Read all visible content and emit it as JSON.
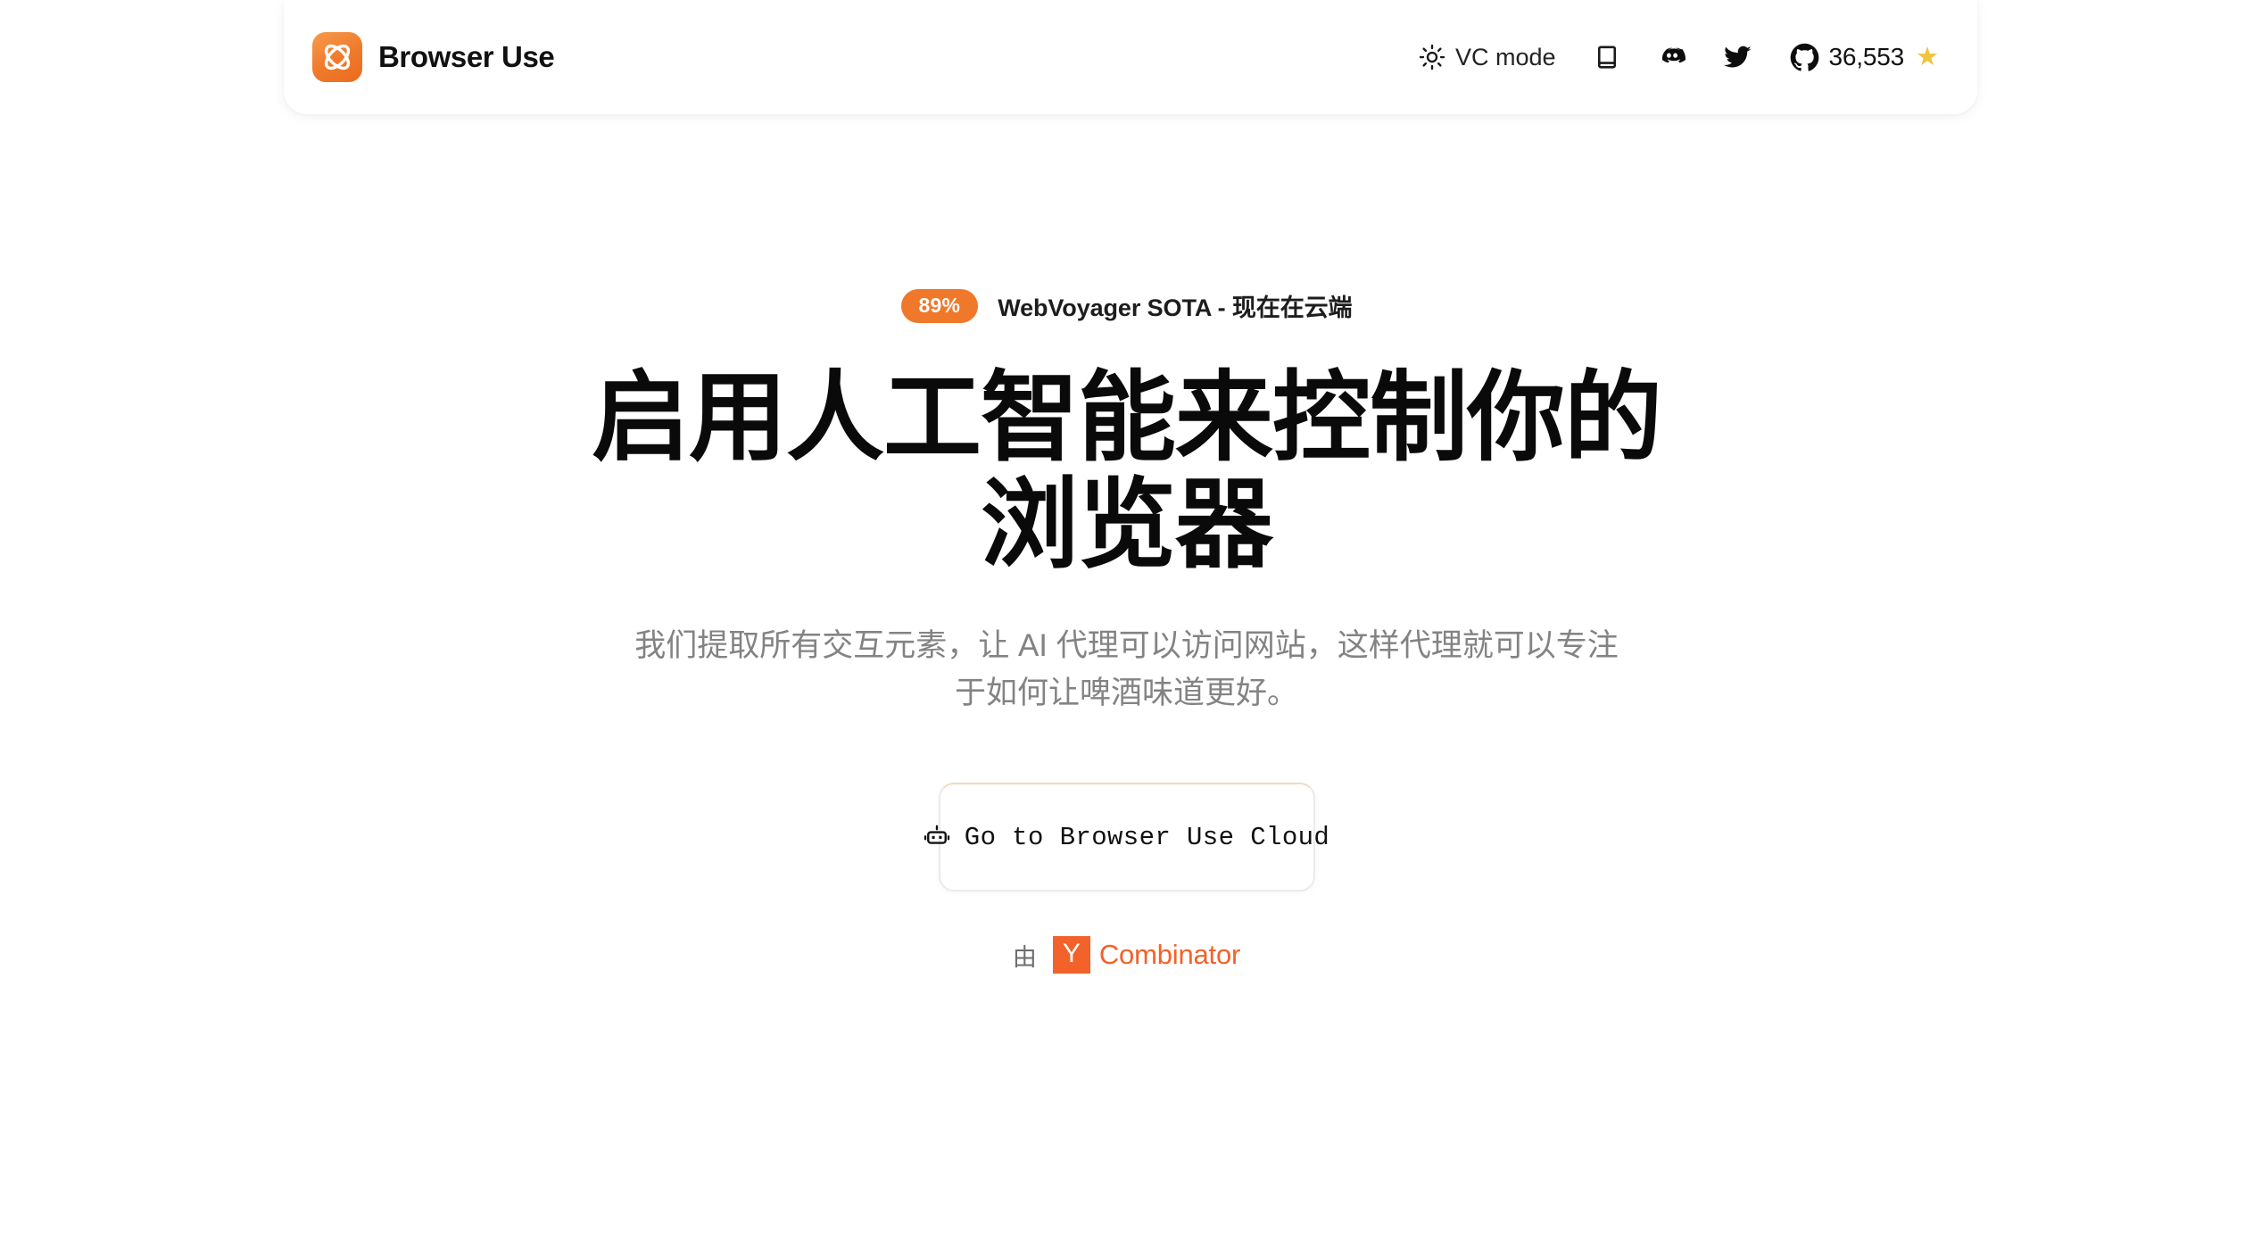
{
  "brand": {
    "logo_icon": "browser-use-atom-logo",
    "name": "Browser Use"
  },
  "nav": {
    "items": [
      {
        "id": "vc-mode",
        "icon": "sun-icon",
        "label": "VC mode"
      },
      {
        "id": "docs",
        "icon": "book-icon",
        "label": ""
      },
      {
        "id": "discord",
        "icon": "discord-icon",
        "label": ""
      },
      {
        "id": "twitter",
        "icon": "twitter-icon",
        "label": ""
      },
      {
        "id": "github",
        "icon": "github-icon",
        "label": "36,553",
        "trailing_icon": "star-icon",
        "star_glyph": "★"
      }
    ]
  },
  "hero": {
    "badge": {
      "pill": "89%",
      "text": "WebVoyager SOTA - 现在在云端"
    },
    "headline": "启用人工智能来控制你的浏览器",
    "subtitle": "我们提取所有交互元素，让 AI 代理可以访问网站，这样代理就可以专注于如何让啤酒味道更好。",
    "cta": {
      "icon": "robot-icon",
      "label": "Go to Browser Use Cloud"
    },
    "backed_by": {
      "prefix": "由",
      "yc_letter": "Y",
      "yc_word": "Combinator"
    }
  },
  "colors": {
    "accent_orange": "#F0782A",
    "yc_orange": "#F2622A",
    "star_yellow": "#F2C33C",
    "page_background": "#FFFFFF",
    "headline": "#0A0A0A",
    "subtitle": "#838383"
  }
}
